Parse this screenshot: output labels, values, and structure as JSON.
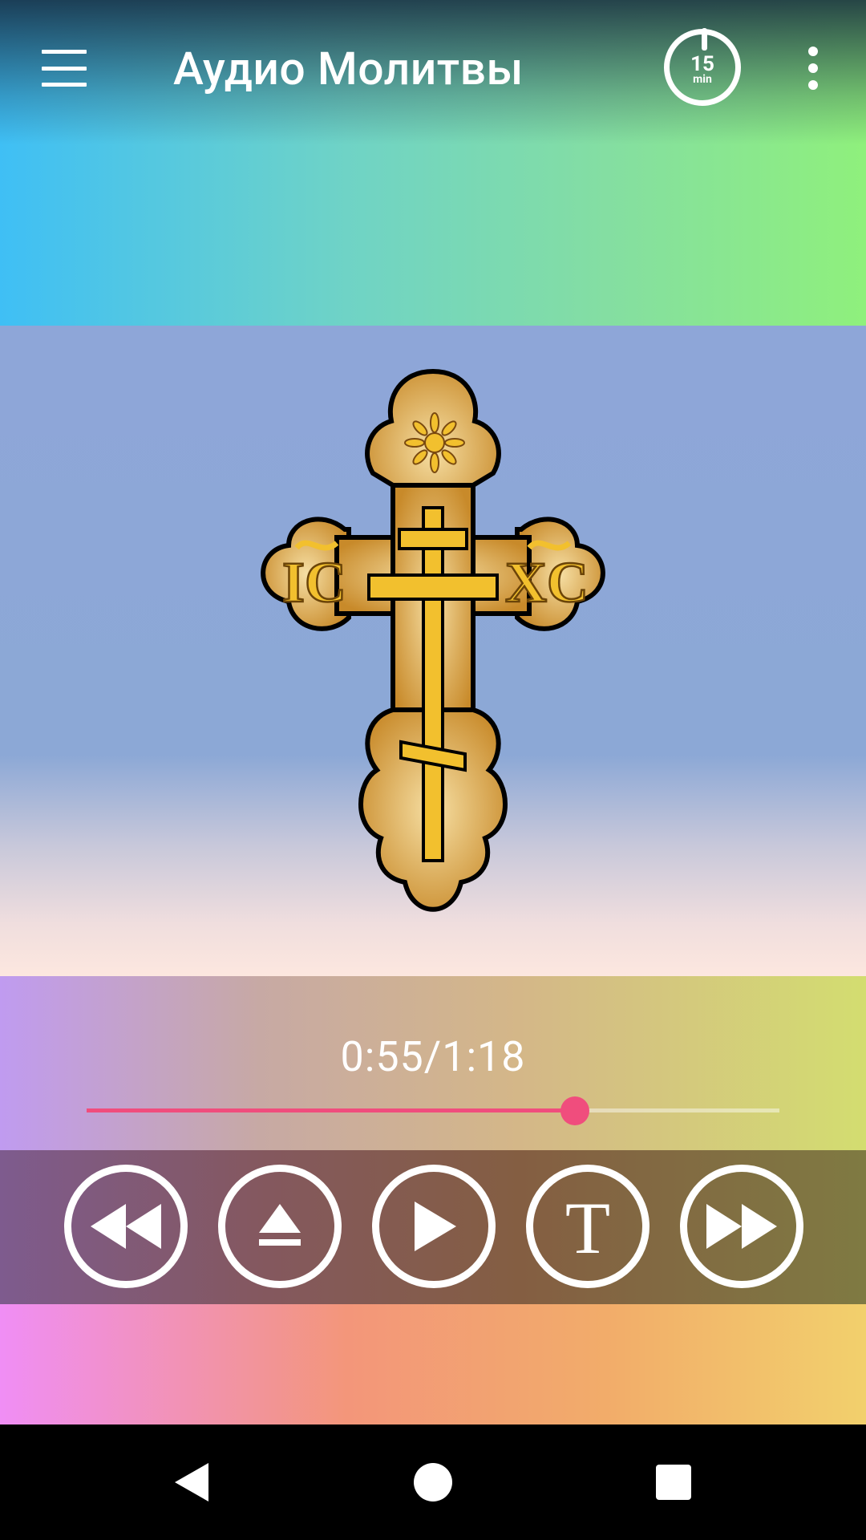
{
  "app_bar": {
    "title": "Аудио Молитвы",
    "timer": {
      "value": "15",
      "unit": "min"
    }
  },
  "artwork": {
    "icon": "orthodox-cross-icon",
    "inscription_left": "IC",
    "inscription_right": "XC"
  },
  "player": {
    "time_display": "0:55/1:18",
    "position_seconds": 55,
    "duration_seconds": 78,
    "progress_fraction": 0.705,
    "accent_color": "#f04d7d",
    "controls": [
      {
        "name": "rewind",
        "icon": "rewind-icon"
      },
      {
        "name": "eject",
        "icon": "eject-icon"
      },
      {
        "name": "play",
        "icon": "play-icon"
      },
      {
        "name": "text",
        "icon": "text-icon",
        "glyph": "T"
      },
      {
        "name": "forward",
        "icon": "fast-forward-icon"
      }
    ]
  },
  "system_nav": {
    "back": "back-icon",
    "home": "home-icon",
    "recents": "recents-icon"
  }
}
